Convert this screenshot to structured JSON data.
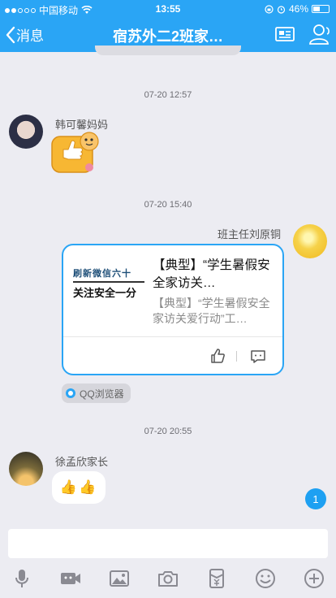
{
  "status_bar": {
    "carrier": "中国移动",
    "time": "13:55",
    "battery": "46%",
    "battery_level": 0.46
  },
  "nav": {
    "back_label": "消息",
    "title": "宿苏外二2班家…"
  },
  "messages": {
    "ts1": "07-20 12:57",
    "sender1": "韩可馨妈妈",
    "ts2": "07-20 15:40",
    "sender2": "班主任刘原铜",
    "card": {
      "thumb_line1": "刷新微信六十",
      "thumb_line2": "关注安全一分",
      "title": "【典型】“学生暑假安全家访关…",
      "desc": "【典型】“学生暑假安全家访关爱行动”工…"
    },
    "source_label": "QQ浏览器",
    "ts3": "07-20 20:55",
    "sender3": "徐孟欣家长",
    "thumbs_text": "👍👍",
    "unread_count": "1"
  },
  "icons": {
    "back": "chevron-left-icon",
    "profile_card": "profile-card-icon",
    "group_members": "group-members-icon",
    "toolbar": [
      "microphone-icon",
      "video-icon",
      "image-icon",
      "camera-icon",
      "red-packet-icon",
      "emoji-icon",
      "plus-icon"
    ]
  },
  "colors": {
    "brand": "#2aa5f5",
    "background": "#ececf2",
    "unread_badge": "#1ea0f2"
  }
}
